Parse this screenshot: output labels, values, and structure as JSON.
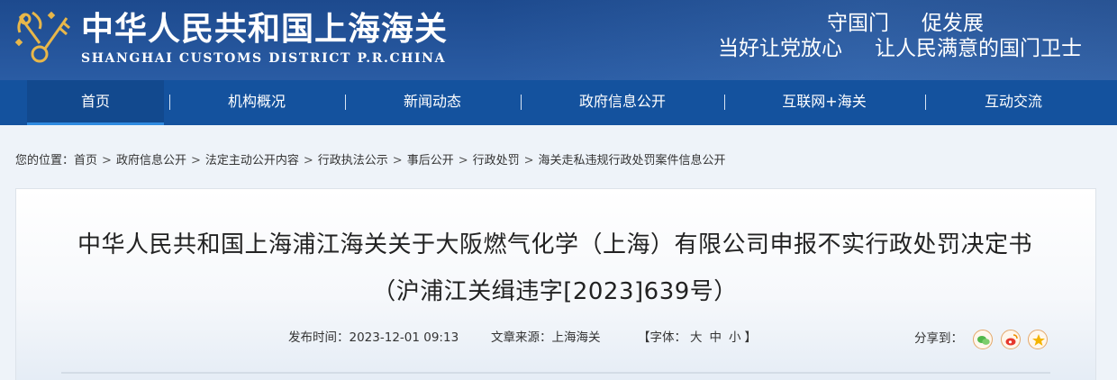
{
  "header": {
    "title": "中华人民共和国上海海关",
    "subtitle": "SHANGHAI CUSTOMS DISTRICT P.R.CHINA",
    "slogan_line1": [
      "守国门",
      "促发展"
    ],
    "slogan_line2": [
      "当好让党放心",
      "让人民满意的国门卫士"
    ]
  },
  "nav": {
    "items": [
      {
        "label": "首页",
        "active": true
      },
      {
        "label": "机构概况"
      },
      {
        "label": "新闻动态"
      },
      {
        "label": "政府信息公开"
      },
      {
        "label": "互联网+海关"
      },
      {
        "label": "互动交流"
      }
    ],
    "separator": "|"
  },
  "breadcrumb": {
    "prefix": "您的位置：",
    "separator": ">",
    "items": [
      "首页",
      "政府信息公开",
      "法定主动公开内容",
      "行政执法公示",
      "事后公开",
      "行政处罚",
      "海关走私违规行政处罚案件信息公开"
    ]
  },
  "article": {
    "title": "中华人民共和国上海浦江海关关于大阪燃气化学（上海）有限公司申报不实行政处罚决定书（沪浦江关缉违字[2023]639号）",
    "publish_label": "发布时间：",
    "publish_time": "2023-12-01 09:13",
    "source_label": "文章来源：",
    "source": "上海海关",
    "font_label_open": "【字体：",
    "font_sizes": [
      "大",
      "中",
      "小"
    ],
    "font_label_close": "】",
    "share_label": "分享到：",
    "share_icons": [
      "wechat-icon",
      "weibo-icon",
      "qzone-icon"
    ]
  },
  "colors": {
    "header_bg": "#1d4a8e",
    "nav_bg": "#14529e",
    "share_border": "#e4a86a"
  }
}
